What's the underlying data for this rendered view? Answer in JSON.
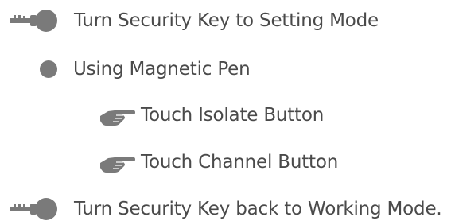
{
  "steps": [
    {
      "icon": "key-icon",
      "text": "Turn Security Key to Setting Mode"
    },
    {
      "icon": "bullet-dot-icon",
      "text": "Using Magnetic Pen"
    },
    {
      "icon": "pointing-hand-icon",
      "text": "Touch Isolate Button"
    },
    {
      "icon": "pointing-hand-icon",
      "text": "Touch Channel Button"
    },
    {
      "icon": "key-icon",
      "text": "Turn Security Key back to Working Mode."
    }
  ],
  "colors": {
    "text": "#4a4a4a",
    "icon": "#7a7a7a"
  }
}
